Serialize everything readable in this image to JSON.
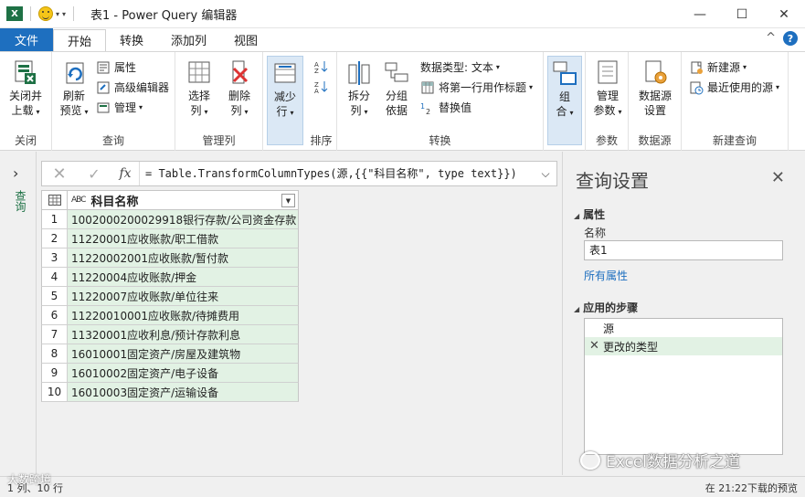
{
  "window": {
    "app_title": "表1 - Power Query 编辑器",
    "logo_text": "X",
    "minimize": "—",
    "maximize": "☐",
    "close": "✕"
  },
  "tabs": {
    "file": "文件",
    "items": [
      "开始",
      "转换",
      "添加列",
      "视图"
    ],
    "active": "开始",
    "collapse_glyph": "^",
    "help_glyph": "?"
  },
  "ribbon": {
    "close_group": {
      "label": "关闭",
      "close_load_line1": "关闭并",
      "close_load_line2": "上载"
    },
    "query_group": {
      "label": "查询",
      "refresh_line1": "刷新",
      "refresh_line2": "预览",
      "properties": "属性",
      "advanced_editor": "高级编辑器",
      "manage": "管理"
    },
    "manage_columns_group": {
      "label": "管理列",
      "choose_line1": "选择",
      "choose_line2": "列",
      "remove_line1": "删除",
      "remove_line2": "列"
    },
    "reduce_rows": {
      "line1": "减少",
      "line2": "行"
    },
    "sort_group": {
      "label": "排序"
    },
    "transform_group": {
      "label": "转换",
      "split_line1": "拆分",
      "split_line2": "列",
      "groupby_line1": "分组",
      "groupby_line2": "依据",
      "data_type": "数据类型: 文本",
      "first_row_header": "将第一行用作标题",
      "replace_values": "替换值"
    },
    "combine": {
      "line1": "组",
      "line2": "合"
    },
    "params_group": {
      "label": "参数",
      "manage_line1": "管理",
      "manage_line2": "参数"
    },
    "datasource_group": {
      "label": "数据源",
      "settings_line1": "数据源",
      "settings_line2": "设置"
    },
    "newquery_group": {
      "label": "新建查询",
      "new_source": "新建源",
      "recent_sources": "最近使用的源"
    }
  },
  "formula": {
    "text": "= Table.TransformColumnTypes(源,{{\"科目名称\", type text}})",
    "cancel_glyph": "✕",
    "commit_glyph": "✓",
    "fx": "fx"
  },
  "grid": {
    "column_header": "科目名称",
    "type_badge": "ABC",
    "rows": [
      {
        "index": "1",
        "value": "1002000200029918银行存款/公司资金存款"
      },
      {
        "index": "2",
        "value": "11220001应收账款/职工借款"
      },
      {
        "index": "3",
        "value": "11220002001应收账款/暂付款"
      },
      {
        "index": "4",
        "value": "11220004应收账款/押金"
      },
      {
        "index": "5",
        "value": "11220007应收账款/单位往来"
      },
      {
        "index": "6",
        "value": "11220010001应收账款/待摊费用"
      },
      {
        "index": "7",
        "value": "11320001应收利息/预计存款利息"
      },
      {
        "index": "8",
        "value": "16010001固定资产/房屋及建筑物"
      },
      {
        "index": "9",
        "value": "16010002固定资产/电子设备"
      },
      {
        "index": "10",
        "value": "16010003固定资产/运输设备"
      }
    ]
  },
  "leftpane": {
    "label": "查询"
  },
  "settings": {
    "title": "查询设置",
    "properties_head": "属性",
    "name_label": "名称",
    "name_value": "表1",
    "all_properties": "所有属性",
    "steps_head": "应用的步骤",
    "steps": [
      "源",
      "更改的类型"
    ]
  },
  "status": {
    "left": "1 列、10 行",
    "right": "在 21:22下载的预览"
  },
  "watermark": {
    "text": "Excel数据分析之道",
    "text2": "大数跨境"
  }
}
